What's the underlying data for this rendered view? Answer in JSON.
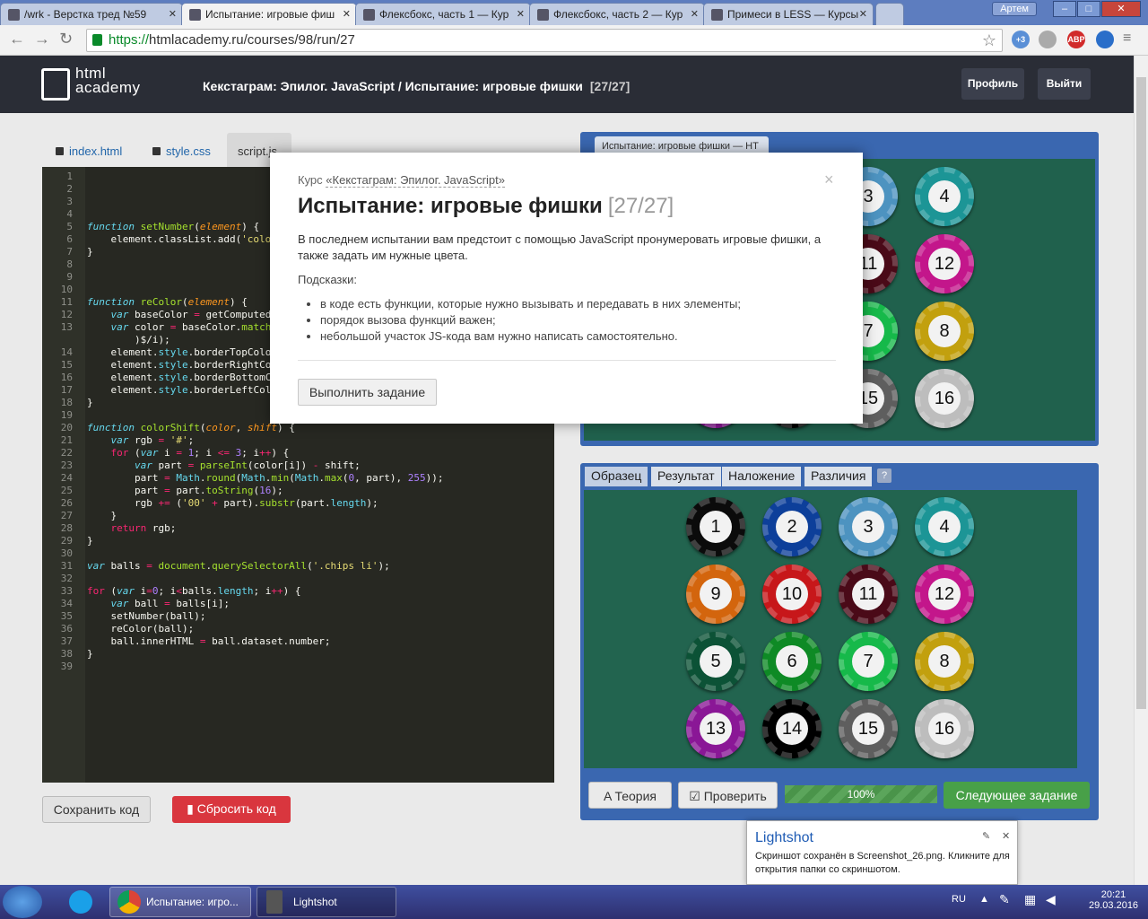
{
  "browser": {
    "tabs": [
      {
        "label": "/wrk - Верстка тред №59"
      },
      {
        "label": "Испытание: игровые фиш"
      },
      {
        "label": "Флексбокс, часть 1 — Кур"
      },
      {
        "label": "Флексбокс, часть 2 — Кур"
      },
      {
        "label": "Примеси в LESS — Курсы"
      }
    ],
    "user": "Артем",
    "url_scheme": "https://",
    "url_rest": "htmlacademy.ru/courses/98/run/27",
    "ext_badge": "+3",
    "abp": "ABP"
  },
  "site": {
    "logo_line1": "html",
    "logo_line2": "academy",
    "breadcrumb": "Кекстаграм: Эпилог. JavaScript / Испытание: игровые фишки",
    "counter": "[27/27]",
    "profile": "Профиль",
    "logout": "Выйти"
  },
  "editor": {
    "files": [
      "index.html",
      "style.css",
      "script.js"
    ],
    "save": "Сохранить код",
    "reset": "Сбросить код"
  },
  "preview": {
    "tab": "Испытание: игровые фишки — HT",
    "view_tabs": [
      "Образец",
      "Результат",
      "Наложение",
      "Различия"
    ],
    "help": "?",
    "theory": "Теория",
    "check": "Проверить",
    "progress": "100%",
    "next": "Следующее задание"
  },
  "balls": [
    {
      "n": "1",
      "color": "#0b0b0b"
    },
    {
      "n": "2",
      "color": "#0d3f9a"
    },
    {
      "n": "3",
      "color": "#4d93c0"
    },
    {
      "n": "4",
      "color": "#1c9596"
    },
    {
      "n": "9",
      "color": "#d3650d"
    },
    {
      "n": "10",
      "color": "#c7171a"
    },
    {
      "n": "11",
      "color": "#4a0a18"
    },
    {
      "n": "12",
      "color": "#c3168b"
    },
    {
      "n": "5",
      "color": "#0c5236"
    },
    {
      "n": "6",
      "color": "#0e8a25"
    },
    {
      "n": "7",
      "color": "#16b94a"
    },
    {
      "n": "8",
      "color": "#c2a00e"
    },
    {
      "n": "13",
      "color": "#8a1796"
    },
    {
      "n": "14",
      "color": "#000000"
    },
    {
      "n": "15",
      "color": "#5e5e5e"
    },
    {
      "n": "16",
      "color": "#bdbdbd"
    }
  ],
  "modal": {
    "course_prefix": "Курс",
    "course_link": "«Кекстаграм: Эпилог. JavaScript»",
    "title": "Испытание: игровые фишки",
    "counter": "[27/27]",
    "description": "В последнем испытании вам предстоит с помощью JavaScript пронумеровать игровые фишки, а также задать им нужные цвета.",
    "hints_title": "Подсказки:",
    "hints": [
      "в коде есть функции, которые нужно вызывать и передавать в них элементы;",
      "порядок вызова функций важен;",
      "небольшой участок JS-кода вам нужно написать самостоятельно."
    ],
    "button": "Выполнить задание",
    "close": "×"
  },
  "lightshot": {
    "title": "Lightshot",
    "message": "Скриншот сохранён в Screenshot_26.png. Кликните для открытия папки со скриншотом."
  },
  "taskbar": {
    "chrome_item": "Испытание: игро...",
    "lightshot_item": "Lightshot",
    "lang": "RU",
    "time": "20:21",
    "date": "29.03.2016"
  }
}
